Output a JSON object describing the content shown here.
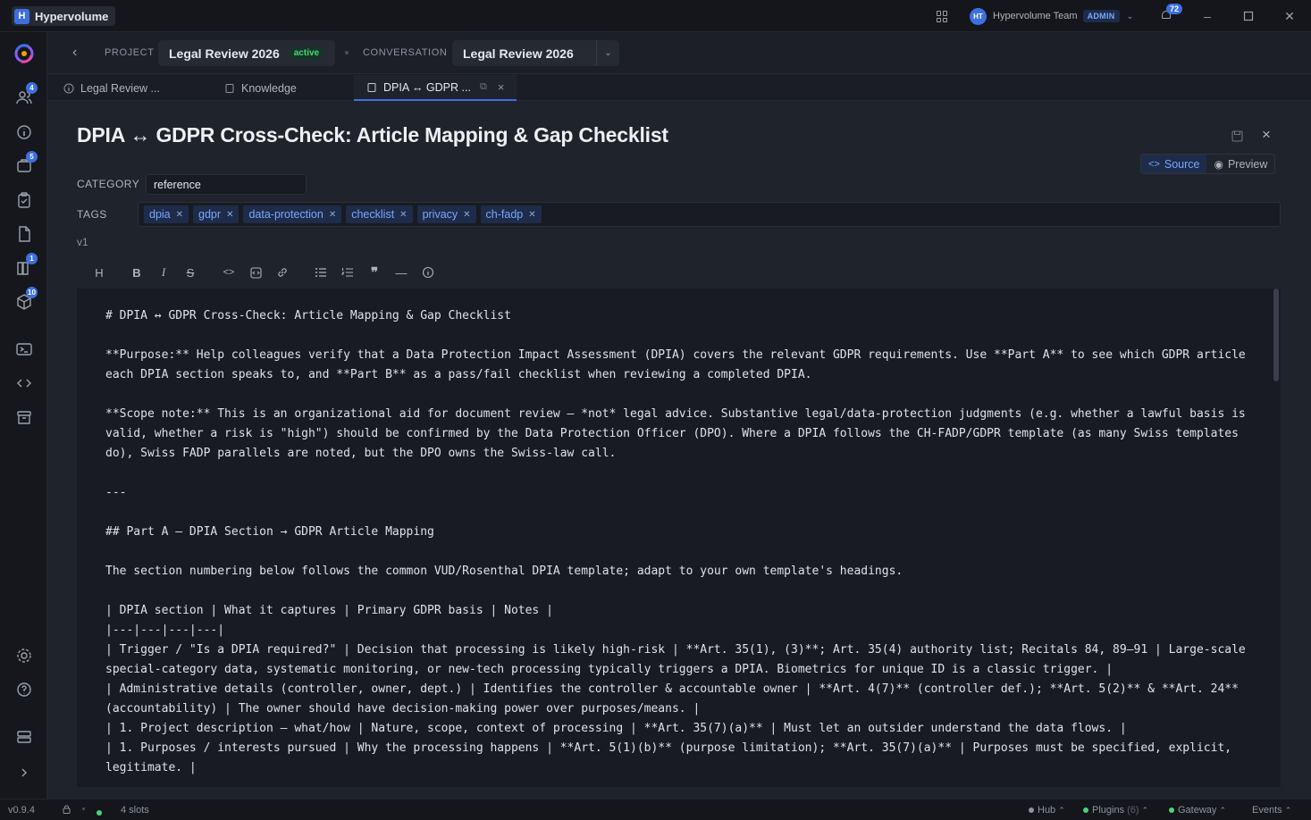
{
  "app": {
    "name": "Hypervolume",
    "logo_letter": "H"
  },
  "titlebar": {
    "team_initials": "HT",
    "team_name": "Hypervolume Team",
    "role_badge": "ADMIN",
    "notification_count": "72"
  },
  "rail": {
    "badges": {
      "team": "4",
      "tasks": "5",
      "library": "1",
      "packages": "10"
    }
  },
  "header": {
    "project_label": "PROJECT",
    "project_name": "Legal Review 2026",
    "project_status": "active",
    "conversation_label": "CONVERSATION",
    "conversation_name": "Legal Review 2026"
  },
  "tabs": [
    {
      "label": "Legal Review ..."
    },
    {
      "label": "Knowledge"
    },
    {
      "label": "DPIA ↔ GDPR ..."
    }
  ],
  "document": {
    "title": "DPIA ↔ GDPR Cross-Check: Article Mapping & Gap Checklist",
    "view_source": "Source",
    "view_preview": "Preview",
    "category_label": "CATEGORY",
    "category_value": "reference",
    "tags_label": "TAGS",
    "tags": [
      "dpia",
      "gdpr",
      "data-protection",
      "checklist",
      "privacy",
      "ch-fadp"
    ],
    "version": "v1",
    "lines": [
      "# DPIA ↔ GDPR Cross-Check: Article Mapping & Gap Checklist",
      "",
      "**Purpose:** Help colleagues verify that a Data Protection Impact Assessment (DPIA) covers the relevant GDPR requirements. Use **Part A** to see which GDPR article each DPIA section speaks to, and **Part B** as a pass/fail checklist when reviewing a completed DPIA.",
      "",
      "**Scope note:** This is an organizational aid for document review — *not* legal advice. Substantive legal/data-protection judgments (e.g. whether a lawful basis is valid, whether a risk is \"high\") should be confirmed by the Data Protection Officer (DPO). Where a DPIA follows the CH-FADP/GDPR template (as many Swiss templates do), Swiss FADP parallels are noted, but the DPO owns the Swiss-law call.",
      "",
      "---",
      "",
      "## Part A — DPIA Section → GDPR Article Mapping",
      "",
      "The section numbering below follows the common VUD/Rosenthal DPIA template; adapt to your own template's headings.",
      "",
      "| DPIA section | What it captures | Primary GDPR basis | Notes |",
      "|---|---|---|---|",
      "| Trigger / \"Is a DPIA required?\" | Decision that processing is likely high-risk | **Art. 35(1), (3)**; Art. 35(4) authority list; Recitals 84, 89–91 | Large-scale special-category data, systematic monitoring, or new-tech processing typically triggers a DPIA. Biometrics for unique ID is a classic trigger. |",
      "| Administrative details (controller, owner, dept.) | Identifies the controller & accountable owner | **Art. 4(7)** (controller def.); **Art. 5(2)** & **Art. 24** (accountability) | The owner should have decision-making power over purposes/means. |",
      "| 1. Project description — what/how | Nature, scope, context of processing | **Art. 35(7)(a)** | Must let an outsider understand the data flows. |",
      "| 1. Purposes / interests pursued | Why the processing happens | **Art. 5(1)(b)** (purpose limitation); **Art. 35(7)(a)** | Purposes must be specified, explicit, legitimate. |"
    ]
  },
  "status": {
    "version": "v0.9.4",
    "slots": "4 slots",
    "hub": "Hub",
    "plugins": "Plugins",
    "plugins_count": "(6)",
    "gateway": "Gateway",
    "events": "Events"
  },
  "colors": {
    "accent": "#3d6fe0",
    "active_green": "#4bd37b",
    "tag_bg": "#1e2c4a",
    "tag_fg": "#7aa6ff"
  }
}
